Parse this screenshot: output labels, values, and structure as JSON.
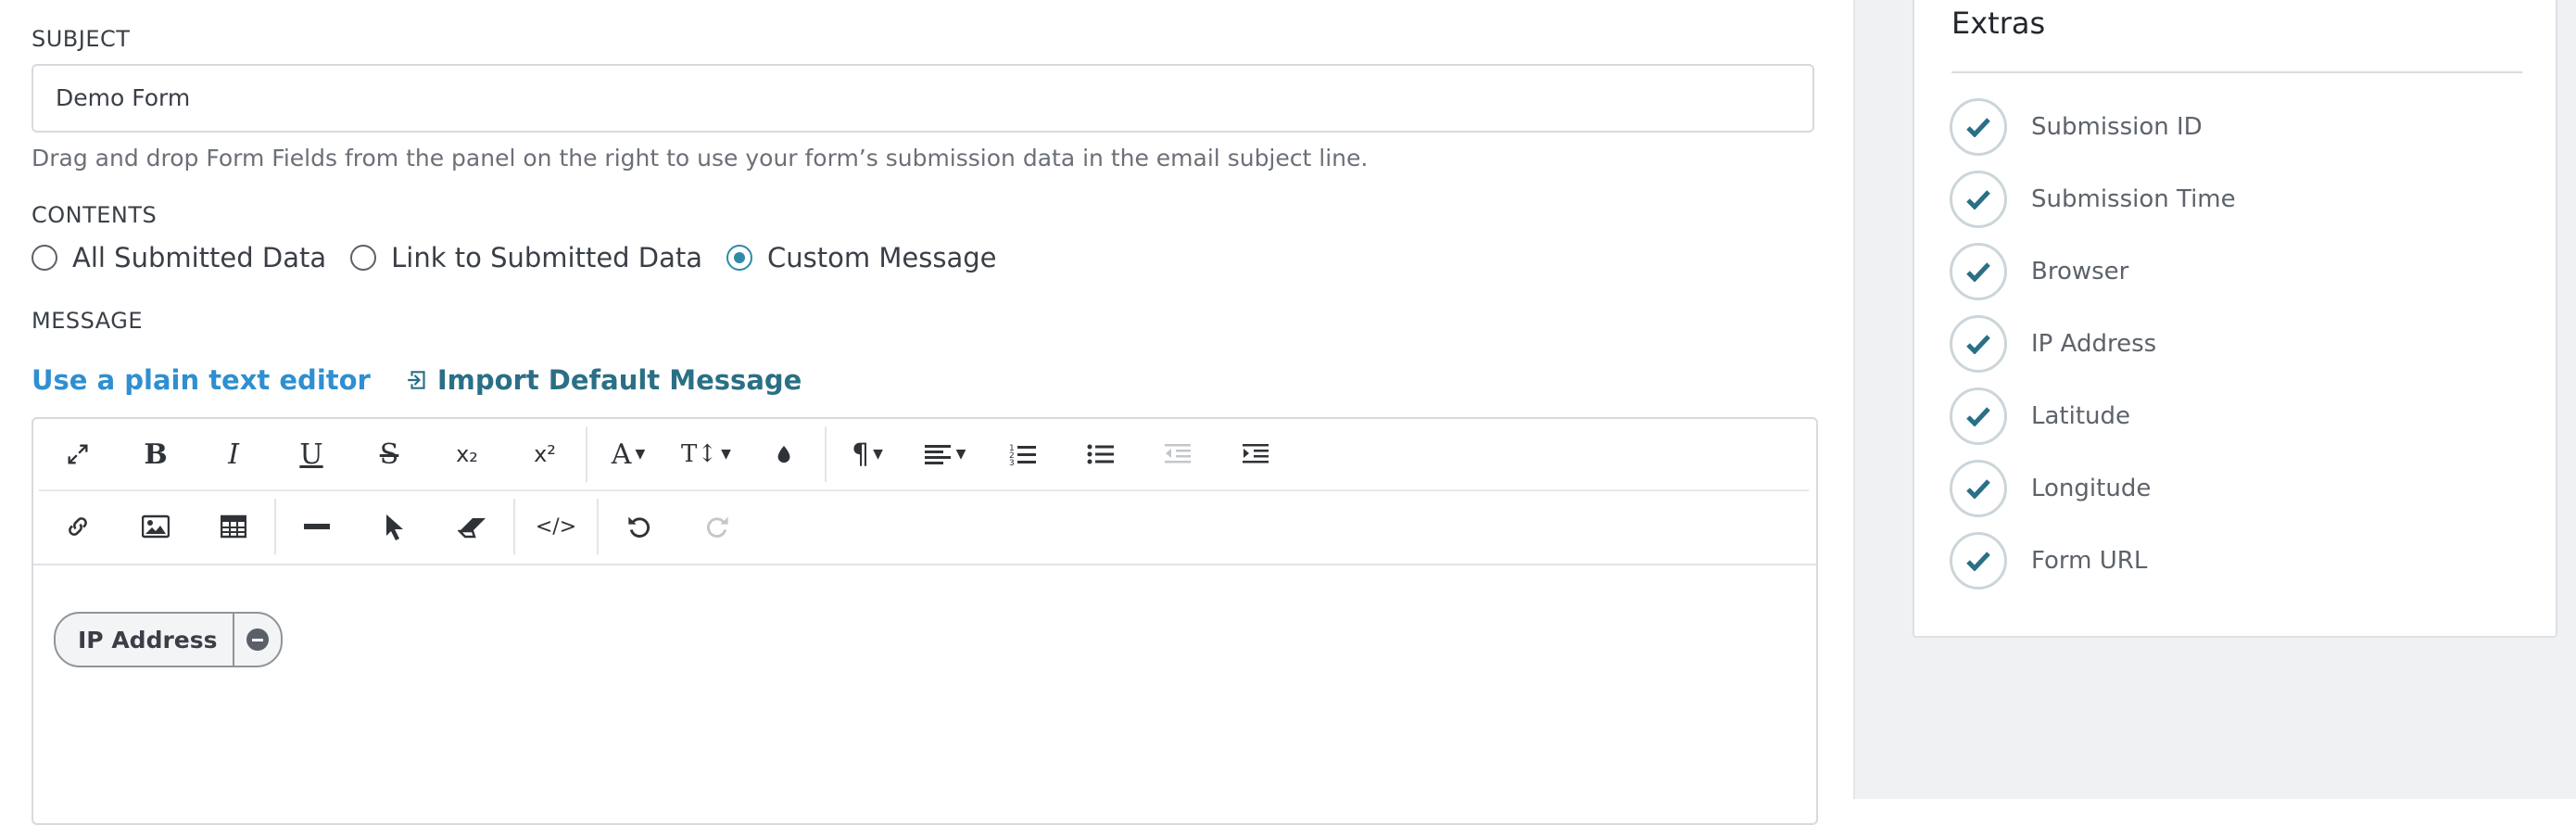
{
  "subject": {
    "label": "SUBJECT",
    "value": "Demo Form",
    "help": "Drag and drop Form Fields from the panel on the right to use your form’s submission data in the email subject line."
  },
  "contents": {
    "label": "CONTENTS",
    "options": [
      "All Submitted Data",
      "Link to Submitted Data",
      "Custom Message"
    ],
    "selected": "Custom Message"
  },
  "message": {
    "label": "MESSAGE",
    "plain_editor_link": "Use a plain text editor",
    "import_link": "Import Default Message",
    "toolbar_row1": [
      "fullscreen-icon",
      "bold-icon",
      "italic-icon",
      "underline-icon",
      "strikethrough-icon",
      "subscript-icon",
      "superscript-icon",
      "font-family-icon",
      "font-size-icon",
      "color-icon",
      "paragraph-icon",
      "align-icon",
      "ordered-list-icon",
      "unordered-list-icon",
      "outdent-icon",
      "indent-icon"
    ],
    "toolbar_row2": [
      "link-icon",
      "image-icon",
      "table-icon",
      "horizontal-rule-icon",
      "pointer-icon",
      "eraser-icon",
      "code-view-icon",
      "undo-icon",
      "redo-icon"
    ],
    "tags": [
      "IP Address"
    ]
  },
  "extras": {
    "title": "Extras",
    "items": [
      "Submission ID",
      "Submission Time",
      "Browser",
      "IP Address",
      "Latitude",
      "Longitude",
      "Form URL"
    ]
  },
  "colors": {
    "accent": "#2f8aa8",
    "link": "#2f8fd0",
    "check": "#2a6f86",
    "panel_bg": "#eff1f3"
  }
}
